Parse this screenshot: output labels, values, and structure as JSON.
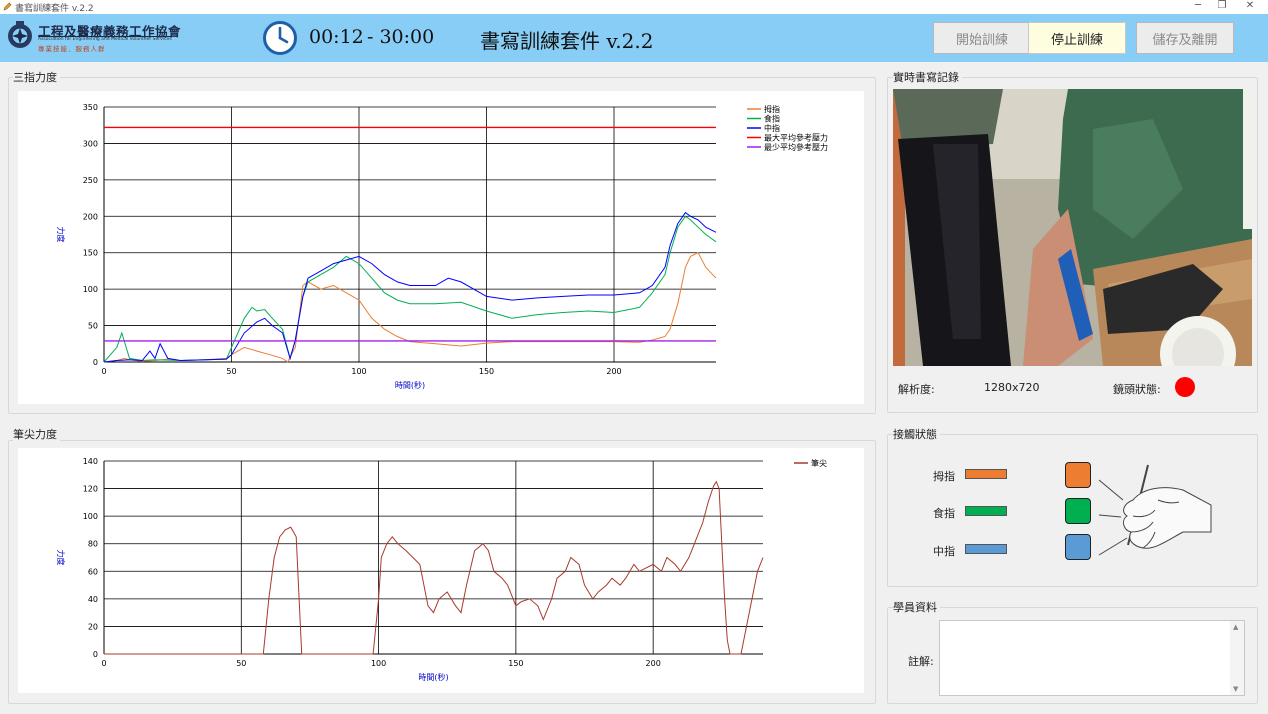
{
  "window": {
    "title": "書寫訓練套件 v.2.2"
  },
  "header": {
    "org_name": "工程及醫療義務工作協會",
    "org_english": "Association for Engineering and Medical Volunteer Services",
    "org_motto": "專業技能．服務人群",
    "timer_elapsed": "00:12",
    "timer_total": "- 30:00",
    "app_title": "書寫訓練套件 v.2.2",
    "buttons": {
      "start": "開始訓練",
      "stop": "停止訓練",
      "save_exit": "儲存及離開"
    }
  },
  "panels": {
    "three_finger": "三指力度",
    "pen_tip": "筆尖力度",
    "live_record": "實時書寫記錄",
    "contact_status": "接觸狀態",
    "student_info": "學員資料"
  },
  "camera": {
    "resolution_label": "解析度:",
    "resolution_value": "1280x720",
    "lens_status_label": "鏡頭狀態:",
    "lens_status_color": "#ff0000"
  },
  "contact": {
    "fingers": [
      {
        "label": "拇指",
        "color": "#ed7d31"
      },
      {
        "label": "食指",
        "color": "#00b050"
      },
      {
        "label": "中指",
        "color": "#5b9bd5"
      }
    ]
  },
  "student": {
    "notes_label": "註解:",
    "notes_value": ""
  },
  "chart_data": [
    {
      "type": "line",
      "xlabel": "時間(秒)",
      "ylabel": "力度",
      "xlim": [
        0,
        240
      ],
      "ylim": [
        0,
        350
      ],
      "xticks": [
        0,
        50,
        100,
        150,
        200
      ],
      "yticks": [
        0,
        50,
        100,
        150,
        200,
        250,
        300,
        350
      ],
      "legend_position": "top-right",
      "series": [
        {
          "name": "拇指",
          "color": "#ed7d31",
          "x": [
            0,
            5,
            8,
            10,
            15,
            20,
            25,
            30,
            40,
            48,
            50,
            55,
            60,
            65,
            70,
            72,
            75,
            78,
            80,
            85,
            90,
            95,
            100,
            105,
            110,
            115,
            120,
            130,
            140,
            150,
            160,
            170,
            180,
            190,
            200,
            210,
            215,
            220,
            222,
            225,
            228,
            230,
            233,
            236,
            240
          ],
          "y": [
            0,
            2,
            5,
            3,
            1,
            2,
            4,
            2,
            3,
            5,
            10,
            20,
            15,
            10,
            5,
            0,
            20,
            105,
            110,
            100,
            105,
            95,
            85,
            60,
            45,
            35,
            28,
            25,
            22,
            26,
            28,
            28,
            28,
            28,
            28,
            27,
            30,
            35,
            45,
            80,
            130,
            145,
            150,
            130,
            115
          ]
        },
        {
          "name": "食指",
          "color": "#00b050",
          "x": [
            0,
            5,
            7,
            10,
            15,
            20,
            30,
            40,
            48,
            50,
            55,
            58,
            60,
            63,
            66,
            70,
            73,
            75,
            78,
            80,
            85,
            90,
            95,
            100,
            105,
            110,
            115,
            120,
            130,
            140,
            150,
            160,
            170,
            180,
            190,
            200,
            210,
            215,
            220,
            222,
            225,
            228,
            230,
            233,
            236,
            240
          ],
          "y": [
            0,
            20,
            40,
            5,
            2,
            3,
            2,
            3,
            4,
            20,
            60,
            75,
            70,
            72,
            60,
            45,
            5,
            30,
            90,
            110,
            120,
            130,
            145,
            135,
            115,
            95,
            85,
            80,
            80,
            82,
            70,
            60,
            65,
            68,
            70,
            68,
            75,
            95,
            120,
            150,
            185,
            200,
            195,
            185,
            175,
            165
          ]
        },
        {
          "name": "中指",
          "color": "#0000ff",
          "x": [
            0,
            5,
            10,
            15,
            18,
            20,
            22,
            25,
            30,
            40,
            48,
            50,
            55,
            60,
            63,
            66,
            70,
            73,
            75,
            78,
            80,
            85,
            90,
            95,
            100,
            105,
            110,
            115,
            120,
            130,
            135,
            140,
            150,
            160,
            170,
            180,
            190,
            200,
            210,
            215,
            220,
            222,
            225,
            228,
            230,
            233,
            236,
            240
          ],
          "y": [
            0,
            2,
            3,
            2,
            15,
            5,
            25,
            5,
            2,
            3,
            4,
            10,
            40,
            55,
            60,
            50,
            40,
            5,
            30,
            90,
            115,
            125,
            135,
            140,
            145,
            135,
            120,
            110,
            105,
            105,
            115,
            110,
            90,
            85,
            88,
            90,
            92,
            92,
            95,
            105,
            130,
            160,
            190,
            205,
            200,
            195,
            185,
            178
          ]
        },
        {
          "name": "最大平均參考壓力",
          "color": "#ff0000",
          "x": [
            0,
            240
          ],
          "y": [
            322,
            322
          ]
        },
        {
          "name": "最少平均參考壓力",
          "color": "#a020f0",
          "x": [
            0,
            240
          ],
          "y": [
            29,
            29
          ]
        }
      ]
    },
    {
      "type": "line",
      "xlabel": "時間(秒)",
      "ylabel": "力度",
      "xlim": [
        0,
        240
      ],
      "ylim": [
        0,
        140
      ],
      "xticks": [
        0,
        50,
        100,
        150,
        200
      ],
      "yticks": [
        0,
        20,
        40,
        60,
        80,
        100,
        120,
        140
      ],
      "legend_position": "top-right",
      "series": [
        {
          "name": "筆尖",
          "color": "#a9392c",
          "x": [
            0,
            58,
            60,
            62,
            64,
            66,
            68,
            70,
            72,
            98,
            100,
            101,
            103,
            105,
            107,
            110,
            115,
            118,
            120,
            122,
            125,
            128,
            130,
            132,
            135,
            138,
            140,
            142,
            145,
            147,
            150,
            152,
            155,
            158,
            160,
            163,
            165,
            168,
            170,
            173,
            175,
            178,
            180,
            183,
            185,
            188,
            190,
            193,
            195,
            200,
            203,
            205,
            208,
            210,
            213,
            215,
            218,
            220,
            222,
            223,
            224,
            225,
            226,
            227,
            228,
            230,
            232,
            234,
            236,
            238,
            240
          ],
          "y": [
            0,
            0,
            40,
            70,
            85,
            90,
            92,
            85,
            0,
            0,
            40,
            70,
            80,
            85,
            80,
            75,
            65,
            35,
            30,
            40,
            45,
            35,
            30,
            50,
            75,
            80,
            75,
            60,
            55,
            50,
            35,
            38,
            40,
            35,
            25,
            40,
            55,
            60,
            70,
            65,
            50,
            40,
            45,
            50,
            55,
            50,
            55,
            65,
            60,
            65,
            60,
            70,
            65,
            60,
            70,
            80,
            95,
            110,
            122,
            125,
            120,
            80,
            40,
            10,
            0,
            0,
            0,
            20,
            40,
            60,
            70
          ]
        }
      ]
    }
  ]
}
